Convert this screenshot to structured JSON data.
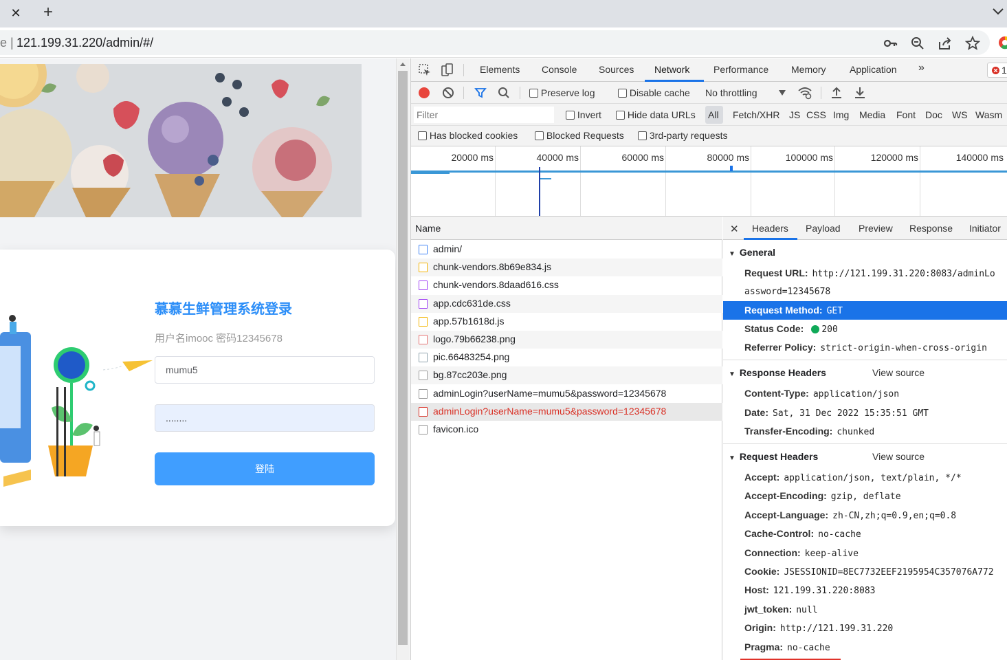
{
  "browser": {
    "url_prefix": "ie",
    "url": "121.199.31.220/admin/#/",
    "tab_close_glyph": "✕",
    "new_tab_glyph": "+",
    "icons": [
      "key-icon",
      "zoom-icon",
      "share-icon",
      "star-icon",
      "chrome-profile-icon"
    ]
  },
  "page": {
    "login_title": "慕慕生鲜管理系统登录",
    "login_hint": "用户名imooc 密码12345678",
    "username_value": "mumu5",
    "password_value": "........",
    "login_button": "登陆",
    "accent": "#409eff"
  },
  "devtools": {
    "tabs": [
      "Elements",
      "Console",
      "Sources",
      "Network",
      "Performance",
      "Memory",
      "Application"
    ],
    "active_tab": "Network",
    "more_tabs": "»",
    "error_badge": "1",
    "toolbar": {
      "preserve_log": "Preserve log",
      "disable_cache": "Disable cache",
      "throttling": "No throttling"
    },
    "filter": {
      "placeholder": "Filter",
      "invert": "Invert",
      "hide_data_urls": "Hide data URLs",
      "types": [
        "All",
        "Fetch/XHR",
        "JS",
        "CSS",
        "Img",
        "Media",
        "Font",
        "Doc",
        "WS",
        "Wasm"
      ]
    },
    "blocked": {
      "has_blocked_cookies": "Has blocked cookies",
      "blocked_requests": "Blocked Requests",
      "third_party": "3rd-party requests"
    },
    "timeline_ticks": [
      "20000 ms",
      "40000 ms",
      "60000 ms",
      "80000 ms",
      "100000 ms",
      "120000 ms",
      "140000 ms"
    ],
    "requests_header": "Name",
    "requests": [
      {
        "name": "admin/",
        "kind": "doc",
        "color": "#4285f4"
      },
      {
        "name": "chunk-vendors.8b69e834.js",
        "kind": "js",
        "color": "#f4b400"
      },
      {
        "name": "chunk-vendors.8daad616.css",
        "kind": "css",
        "color": "#a142f4"
      },
      {
        "name": "app.cdc631de.css",
        "kind": "css",
        "color": "#a142f4"
      },
      {
        "name": "app.57b1618d.js",
        "kind": "js",
        "color": "#f4b400"
      },
      {
        "name": "logo.79b66238.png",
        "kind": "img",
        "color": "#e57373"
      },
      {
        "name": "pic.66483254.png",
        "kind": "img",
        "color": "#90a4ae"
      },
      {
        "name": "bg.87cc203e.png",
        "kind": "img",
        "color": "#9e9e9e"
      },
      {
        "name": "adminLogin?userName=mumu5&password=12345678",
        "kind": "xhr",
        "color": "#999"
      },
      {
        "name": "adminLogin?userName=mumu5&password=12345678",
        "kind": "xhr-error",
        "color": "#d93025"
      },
      {
        "name": "favicon.ico",
        "kind": "other",
        "color": "#999"
      }
    ],
    "detail_tabs": [
      "Headers",
      "Payload",
      "Preview",
      "Response",
      "Initiator"
    ],
    "detail_active_tab": "Headers",
    "general": {
      "title": "General",
      "request_url_key": "Request URL:",
      "request_url_value": "http://121.199.31.220:8083/adminLo",
      "request_url_wrap": "assword=12345678",
      "request_method_key": "Request Method:",
      "request_method_value": "GET",
      "status_code_key": "Status Code:",
      "status_code_value": "200",
      "referrer_policy_key": "Referrer Policy:",
      "referrer_policy_value": "strict-origin-when-cross-origin"
    },
    "response_headers": {
      "title": "Response Headers",
      "view_source": "View source",
      "rows": [
        {
          "k": "Content-Type:",
          "v": "application/json"
        },
        {
          "k": "Date:",
          "v": "Sat, 31 Dec 2022 15:35:51 GMT"
        },
        {
          "k": "Transfer-Encoding:",
          "v": "chunked"
        }
      ]
    },
    "request_headers": {
      "title": "Request Headers",
      "view_source": "View source",
      "rows": [
        {
          "k": "Accept:",
          "v": "application/json, text/plain, */*"
        },
        {
          "k": "Accept-Encoding:",
          "v": "gzip, deflate"
        },
        {
          "k": "Accept-Language:",
          "v": "zh-CN,zh;q=0.9,en;q=0.8"
        },
        {
          "k": "Cache-Control:",
          "v": "no-cache"
        },
        {
          "k": "Connection:",
          "v": "keep-alive"
        },
        {
          "k": "Cookie:",
          "v": "JSESSIONID=8EC7732EEF2195954C357076A772"
        },
        {
          "k": "Host:",
          "v": "121.199.31.220:8083"
        },
        {
          "k": "jwt_token:",
          "v": "null"
        },
        {
          "k": "Origin:",
          "v": "http://121.199.31.220"
        },
        {
          "k": "Pragma:",
          "v": "no-cache"
        }
      ]
    }
  }
}
